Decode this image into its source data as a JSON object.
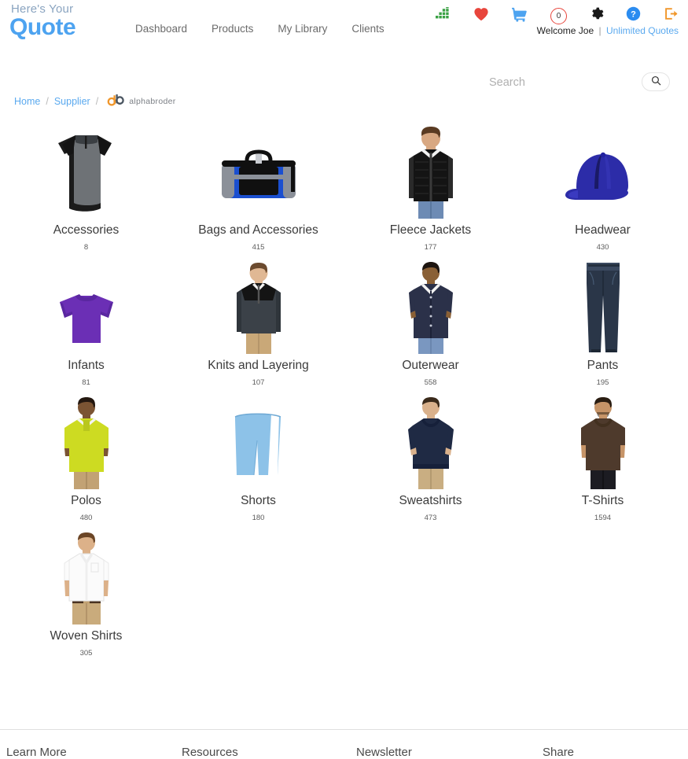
{
  "brand": {
    "logo_top": "Here's Your",
    "logo_bottom": "Quote"
  },
  "nav": {
    "items": [
      {
        "label": "Dashboard"
      },
      {
        "label": "Products"
      },
      {
        "label": "My Library"
      },
      {
        "label": "Clients"
      }
    ]
  },
  "header_icons": [
    {
      "name": "analytics-icon",
      "color": "#3aa144"
    },
    {
      "name": "heart-icon",
      "color": "#e8453c"
    },
    {
      "name": "cart-icon",
      "color": "#4da3f0"
    },
    {
      "name": "cart-count-badge",
      "value": "0",
      "color": "#e8453c"
    },
    {
      "name": "gear-icon",
      "color": "#1a1a1a"
    },
    {
      "name": "help-icon",
      "color": "#2b8cf0"
    },
    {
      "name": "logout-icon",
      "color": "#f0962a"
    }
  ],
  "account": {
    "welcome": "Welcome Joe",
    "separator": "|",
    "quotes_label": "Unlimited Quotes"
  },
  "search": {
    "placeholder": "Search",
    "value": "",
    "button_icon": "search-icon"
  },
  "breadcrumb": {
    "home": "Home",
    "supplier": "Supplier",
    "separator": "/",
    "supplier_logo_text": "alphabroder",
    "supplier_logo_colors": {
      "mark_orange": "#f0962a",
      "mark_dark": "#4a5560"
    }
  },
  "categories": [
    {
      "label": "Accessories",
      "count": "8",
      "image": "quarter-zip-pullover"
    },
    {
      "label": "Bags and Accessories",
      "count": "415",
      "image": "duffel-bag"
    },
    {
      "label": "Fleece Jackets",
      "count": "177",
      "image": "man-black-puffer-jacket"
    },
    {
      "label": "Headwear",
      "count": "430",
      "image": "blue-baseball-cap"
    },
    {
      "label": "Infants",
      "count": "81",
      "image": "purple-infant-tee"
    },
    {
      "label": "Knits and Layering",
      "count": "107",
      "image": "man-quarter-zip-knit"
    },
    {
      "label": "Outerwear",
      "count": "558",
      "image": "man-navy-button-jersey"
    },
    {
      "label": "Pants",
      "count": "195",
      "image": "denim-jeans"
    },
    {
      "label": "Polos",
      "count": "480",
      "image": "man-yellow-polo"
    },
    {
      "label": "Shorts",
      "count": "180",
      "image": "light-blue-shorts"
    },
    {
      "label": "Sweatshirts",
      "count": "473",
      "image": "man-navy-crewneck"
    },
    {
      "label": "T-Shirts",
      "count": "1594",
      "image": "man-brown-tshirt"
    },
    {
      "label": "Woven Shirts",
      "count": "305",
      "image": "man-white-dress-shirt"
    }
  ],
  "footer": {
    "columns": [
      {
        "heading": "Learn More"
      },
      {
        "heading": "Resources"
      },
      {
        "heading": "Newsletter"
      },
      {
        "heading": "Share"
      }
    ]
  }
}
